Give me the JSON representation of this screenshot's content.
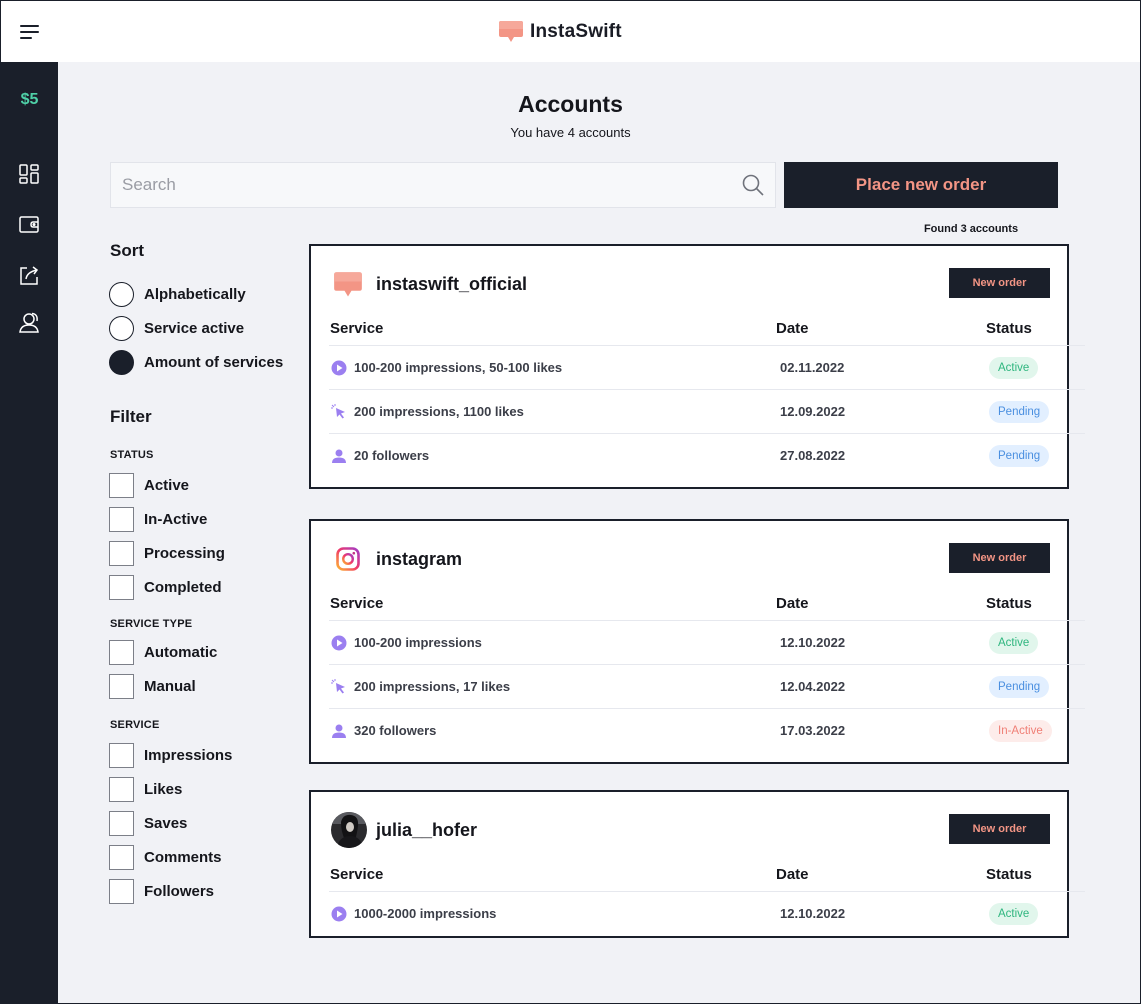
{
  "app": {
    "name": "InstaSwift"
  },
  "sidebar": {
    "balance": "$5",
    "icons": [
      "dashboard-icon",
      "wallet-icon",
      "share-icon",
      "users-icon"
    ]
  },
  "main": {
    "title": "Accounts",
    "subtitle": "You have 4 accounts"
  },
  "search": {
    "placeholder": "Search",
    "value": ""
  },
  "actions": {
    "place_order_label": "Place new order",
    "found_text": "Found 3 accounts"
  },
  "sort": {
    "title": "Sort",
    "options": [
      {
        "label": "Alphabetically",
        "checked": false
      },
      {
        "label": "Service active",
        "checked": false
      },
      {
        "label": "Amount of services",
        "checked": true
      }
    ]
  },
  "filter": {
    "title": "Filter",
    "status": {
      "label": "STATUS",
      "options": [
        "Active",
        "In-Active",
        "Processing",
        "Completed"
      ]
    },
    "service_type": {
      "label": "SERVICE TYPE",
      "options": [
        "Automatic",
        "Manual"
      ]
    },
    "service": {
      "label": "SERVICE",
      "options": [
        "Impressions",
        "Likes",
        "Saves",
        "Comments",
        "Followers"
      ]
    }
  },
  "table_headers": {
    "service": "Service",
    "date": "Date",
    "status": "Status"
  },
  "accounts": [
    {
      "name": "instaswift_official",
      "avatar": "instaswift-logo-icon",
      "new_order_label": "New order",
      "rows": [
        {
          "icon": "play-icon",
          "service": "100-200 impressions, 50-100 likes",
          "date": "02.11.2022",
          "status": "Active",
          "status_type": "active"
        },
        {
          "icon": "cursor-click-icon",
          "service": "200 impressions, 1100 likes",
          "date": "12.09.2022",
          "status": "Pending",
          "status_type": "pending"
        },
        {
          "icon": "person-icon",
          "service": "20 followers",
          "date": "27.08.2022",
          "status": "Pending",
          "status_type": "pending"
        }
      ]
    },
    {
      "name": "instagram",
      "avatar": "instagram-logo-icon",
      "new_order_label": "New order",
      "rows": [
        {
          "icon": "play-icon",
          "service": "100-200 impressions",
          "date": "12.10.2022",
          "status": "Active",
          "status_type": "active"
        },
        {
          "icon": "cursor-click-icon",
          "service": "200 impressions, 17 likes",
          "date": "12.04.2022",
          "status": "Pending",
          "status_type": "pending"
        },
        {
          "icon": "person-icon",
          "service": "320 followers",
          "date": "17.03.2022",
          "status": "In-Active",
          "status_type": "inactive"
        }
      ]
    },
    {
      "name": "julia__hofer",
      "avatar": "profile-photo",
      "new_order_label": "New order",
      "rows": [
        {
          "icon": "play-icon",
          "service": "1000-2000 impressions",
          "date": "12.10.2022",
          "status": "Active",
          "status_type": "active"
        }
      ]
    }
  ],
  "colors": {
    "dark": "#1a1f2a",
    "accent": "#f39585",
    "balance": "#4fd1a8",
    "background": "#f1f2f6",
    "icon_purple": "#9b7ff0"
  }
}
